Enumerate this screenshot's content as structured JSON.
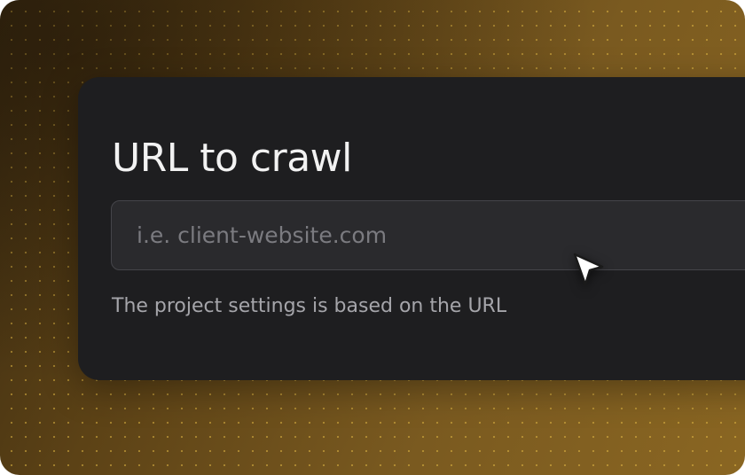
{
  "form": {
    "title": "URL to crawl",
    "url_input": {
      "value": "",
      "placeholder": "i.e. client-website.com"
    },
    "helper_text": "The project settings is based on the URL"
  },
  "icons": {
    "cursor": "mouse-pointer-icon"
  },
  "colors": {
    "background_gradient_start": "#3a2a10",
    "background_gradient_end": "#8a6622",
    "dot_color": "#e8be46",
    "card_background": "#1e1e20",
    "input_background": "#2a2a2d",
    "input_border": "#45454a",
    "title_color": "#f2f2f2",
    "placeholder_color": "#7b7b80",
    "helper_color": "#a5a5aa"
  }
}
